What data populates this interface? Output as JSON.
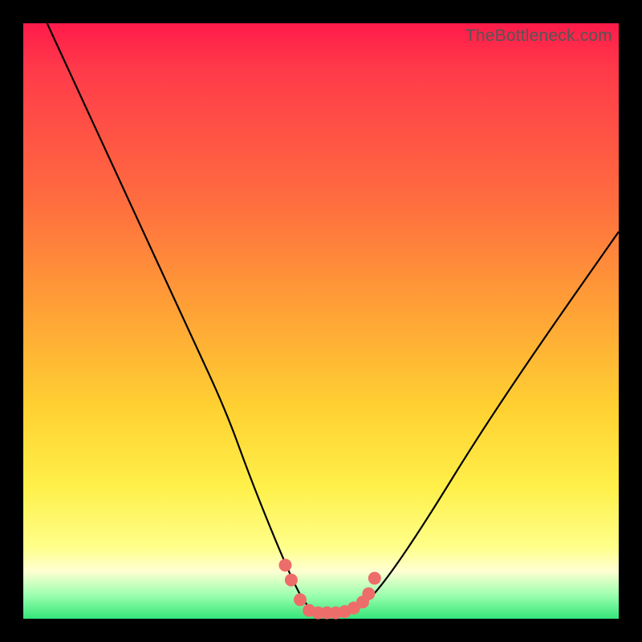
{
  "watermark": "TheBottleneck.com",
  "chart_data": {
    "type": "line",
    "title": "",
    "xlabel": "",
    "ylabel": "",
    "xlim": [
      0,
      100
    ],
    "ylim": [
      0,
      100
    ],
    "series": [
      {
        "name": "bottleneck-curve",
        "x": [
          4,
          10,
          16,
          22,
          28,
          34,
          38,
          42,
          45,
          47,
          48.5,
          50,
          52,
          54,
          56,
          58,
          62,
          68,
          76,
          86,
          100
        ],
        "y": [
          100,
          87,
          74,
          61,
          48,
          35,
          24,
          14,
          7,
          3,
          1.5,
          1,
          1,
          1.2,
          1.8,
          3,
          8,
          17,
          30,
          45,
          65
        ]
      }
    ],
    "markers": {
      "name": "highlight-dots",
      "x": [
        44,
        45,
        46.5,
        48,
        49.5,
        51,
        52.5,
        54,
        55.5,
        57,
        58,
        59
      ],
      "y": [
        9,
        6.5,
        3.2,
        1.4,
        1,
        1,
        1,
        1.2,
        1.8,
        2.8,
        4.2,
        6.8
      ],
      "color": "#ed6d6a",
      "radius": 8
    },
    "colors": {
      "curve": "#000000",
      "gradient_top": "#ff1b4a",
      "gradient_mid1": "#ffa136",
      "gradient_mid2": "#fff04a",
      "gradient_bottom": "#34e57a",
      "frame": "#000000"
    }
  }
}
